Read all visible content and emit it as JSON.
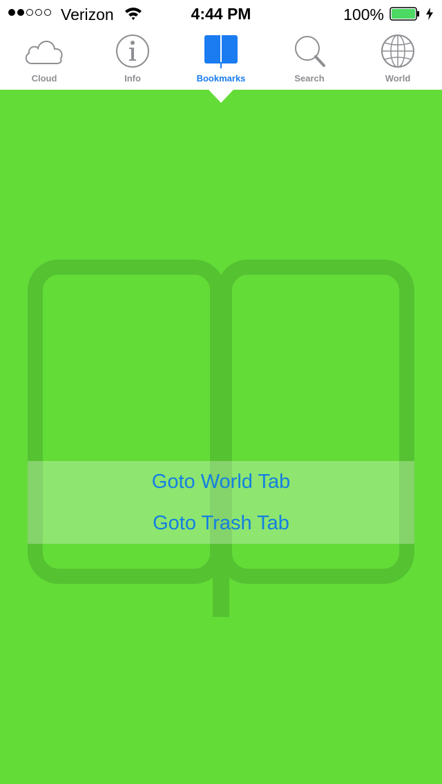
{
  "status_bar": {
    "carrier": "Verizon",
    "time": "4:44 PM",
    "battery_percent": "100%",
    "signal_bars_filled": 2,
    "signal_bars_total": 5
  },
  "tabs": [
    {
      "label": "Cloud",
      "icon": "cloud-icon",
      "active": false
    },
    {
      "label": "Info",
      "icon": "info-icon",
      "active": false
    },
    {
      "label": "Bookmarks",
      "icon": "bookmarks-icon",
      "active": true
    },
    {
      "label": "Search",
      "icon": "search-icon",
      "active": false
    },
    {
      "label": "World",
      "icon": "globe-icon",
      "active": false
    }
  ],
  "actions": {
    "goto_world": "Goto World Tab",
    "goto_trash": "Goto Trash Tab"
  },
  "colors": {
    "background": "#63dc38",
    "accent": "#1a7cf0",
    "inactive_tab": "#8e8e93",
    "battery": "#4cd964"
  }
}
